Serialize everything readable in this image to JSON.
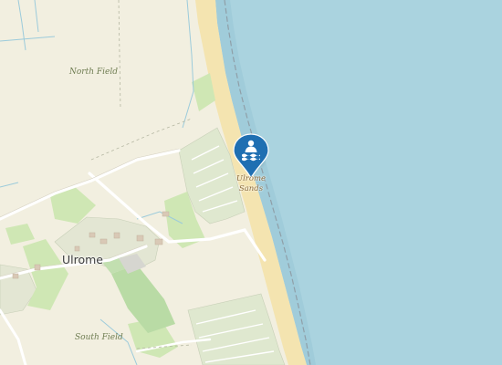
{
  "map": {
    "colors": {
      "land": "#f2efe0",
      "sea": "#aad3df",
      "beach": "#f4e4b0",
      "residential": "#dfe8cf",
      "grass": "#c8e3ad",
      "wood": "#add19e",
      "water_lines": "#8cc6d8",
      "road": "#ffffff",
      "marker": "#1f6fb2"
    },
    "labels": {
      "north_field": "North Field",
      "south_field": "South Field",
      "ulrome": "Ulrome",
      "sands_line1": "Ulrome",
      "sands_line2": "Sands"
    },
    "marker": {
      "icon": "swimming-water-icon",
      "place": "Ulrome Sands"
    }
  }
}
